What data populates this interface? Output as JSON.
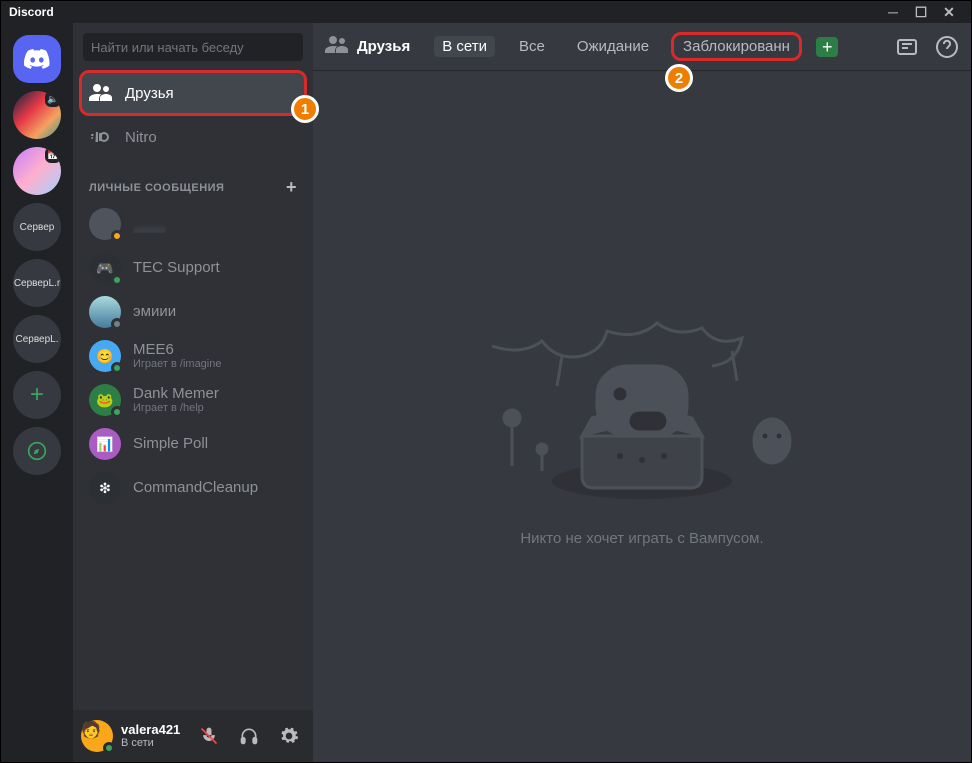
{
  "titlebar": {
    "title": "Discord"
  },
  "servers": {
    "s3": "Сервер",
    "s4": "СерверL.r",
    "s5": "СерверL."
  },
  "sidebar": {
    "search_placeholder": "Найти или начать беседу",
    "friends_label": "Друзья",
    "nitro_label": "Nitro",
    "dm_header": "ЛИЧНЫЕ СООБЩЕНИЯ",
    "dms": [
      {
        "name": "____",
        "sub": ""
      },
      {
        "name": "TEC Support",
        "sub": ""
      },
      {
        "name": "эмиии",
        "sub": ""
      },
      {
        "name": "MEE6",
        "sub": "Играет в /imagine"
      },
      {
        "name": "Dank Memer",
        "sub": "Играет в /help"
      },
      {
        "name": "Simple Poll",
        "sub": ""
      },
      {
        "name": "CommandCleanup",
        "sub": ""
      }
    ]
  },
  "user_panel": {
    "name": "valera421",
    "status": "В сети"
  },
  "header": {
    "title": "Друзья",
    "tabs": {
      "online": "В сети",
      "all": "Все",
      "pending": "Ожидание",
      "blocked": "Заблокированн"
    }
  },
  "empty_state": {
    "text": "Никто не хочет играть с Вампусом."
  },
  "annotations": {
    "step1": "1",
    "step2": "2"
  }
}
